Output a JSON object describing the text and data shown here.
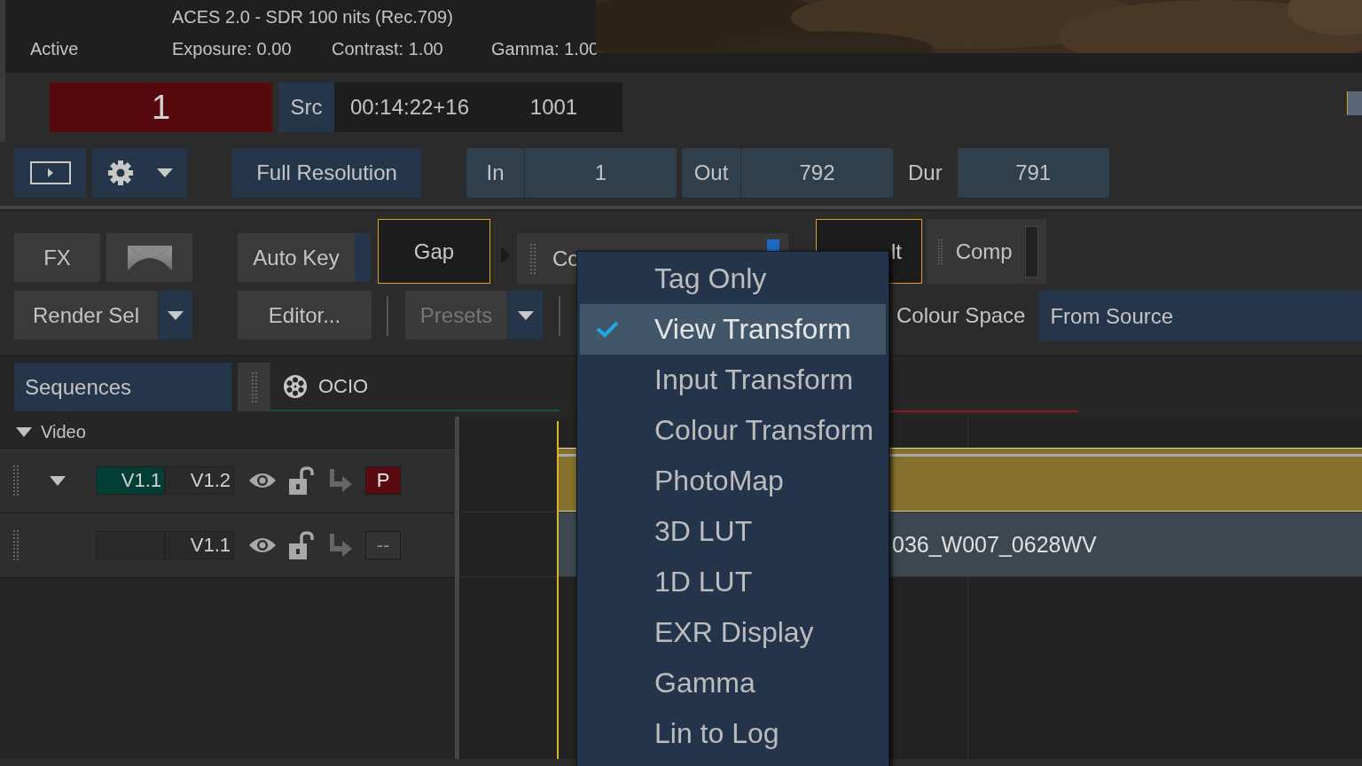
{
  "viewer": {
    "colourspace": "ACES 2.0 - SDR 100 nits (Rec.709)",
    "status": "Active",
    "exposure": "Exposure: 0.00",
    "contrast": "Contrast: 1.00",
    "gamma": "Gamma: 1.00"
  },
  "transport": {
    "frame": "1",
    "source_label": "Src",
    "timecode": "00:14:22+16",
    "frame_number": "1001"
  },
  "range": {
    "resolution": "Full Resolution",
    "in_label": "In",
    "in_value": "1",
    "out_label": "Out",
    "out_value": "792",
    "dur_label": "Dur",
    "dur_value": "791"
  },
  "nodes": {
    "fx": "FX",
    "auto_key": "Auto Key",
    "gap": {
      "label": "Gap",
      "selected": true
    },
    "colour_node": "Co",
    "result": {
      "label": "lt",
      "selected": true
    },
    "comp": "Comp"
  },
  "actions": {
    "render": "Render Sel",
    "editor": "Editor...",
    "presets": {
      "label": "Presets",
      "disabled": true
    },
    "colour_space_label": "Colour Space",
    "colour_space_value": "From Source"
  },
  "panel_title": "Sequences",
  "tab": {
    "label": "OCIO"
  },
  "tracks": {
    "group": {
      "label": "Video",
      "expanded": true
    },
    "rows": [
      {
        "versions": [
          {
            "label": "V1.1",
            "selected": true
          },
          {
            "label": "V1.2",
            "selected": false
          }
        ],
        "has_children": true,
        "target": "P",
        "target_on": true,
        "clip": {
          "kind": "gap"
        }
      },
      {
        "versions": [
          {
            "label": "V1.1",
            "selected": false
          }
        ],
        "has_children": false,
        "target": "--",
        "target_on": false,
        "clip": {
          "kind": "shot",
          "name": "036_W007_0628WV"
        }
      }
    ]
  },
  "menu": {
    "items": [
      {
        "label": "Tag Only",
        "selected": false
      },
      {
        "label": "View Transform",
        "selected": true
      },
      {
        "label": "Input Transform",
        "selected": false
      },
      {
        "label": "Colour Transform",
        "selected": false
      },
      {
        "label": "PhotoMap",
        "selected": false
      },
      {
        "label": "3D LUT",
        "selected": false
      },
      {
        "label": "1D LUT",
        "selected": false
      },
      {
        "label": "EXR Display",
        "selected": false
      },
      {
        "label": "Gamma",
        "selected": false
      },
      {
        "label": "Lin to Log",
        "selected": false
      }
    ]
  }
}
